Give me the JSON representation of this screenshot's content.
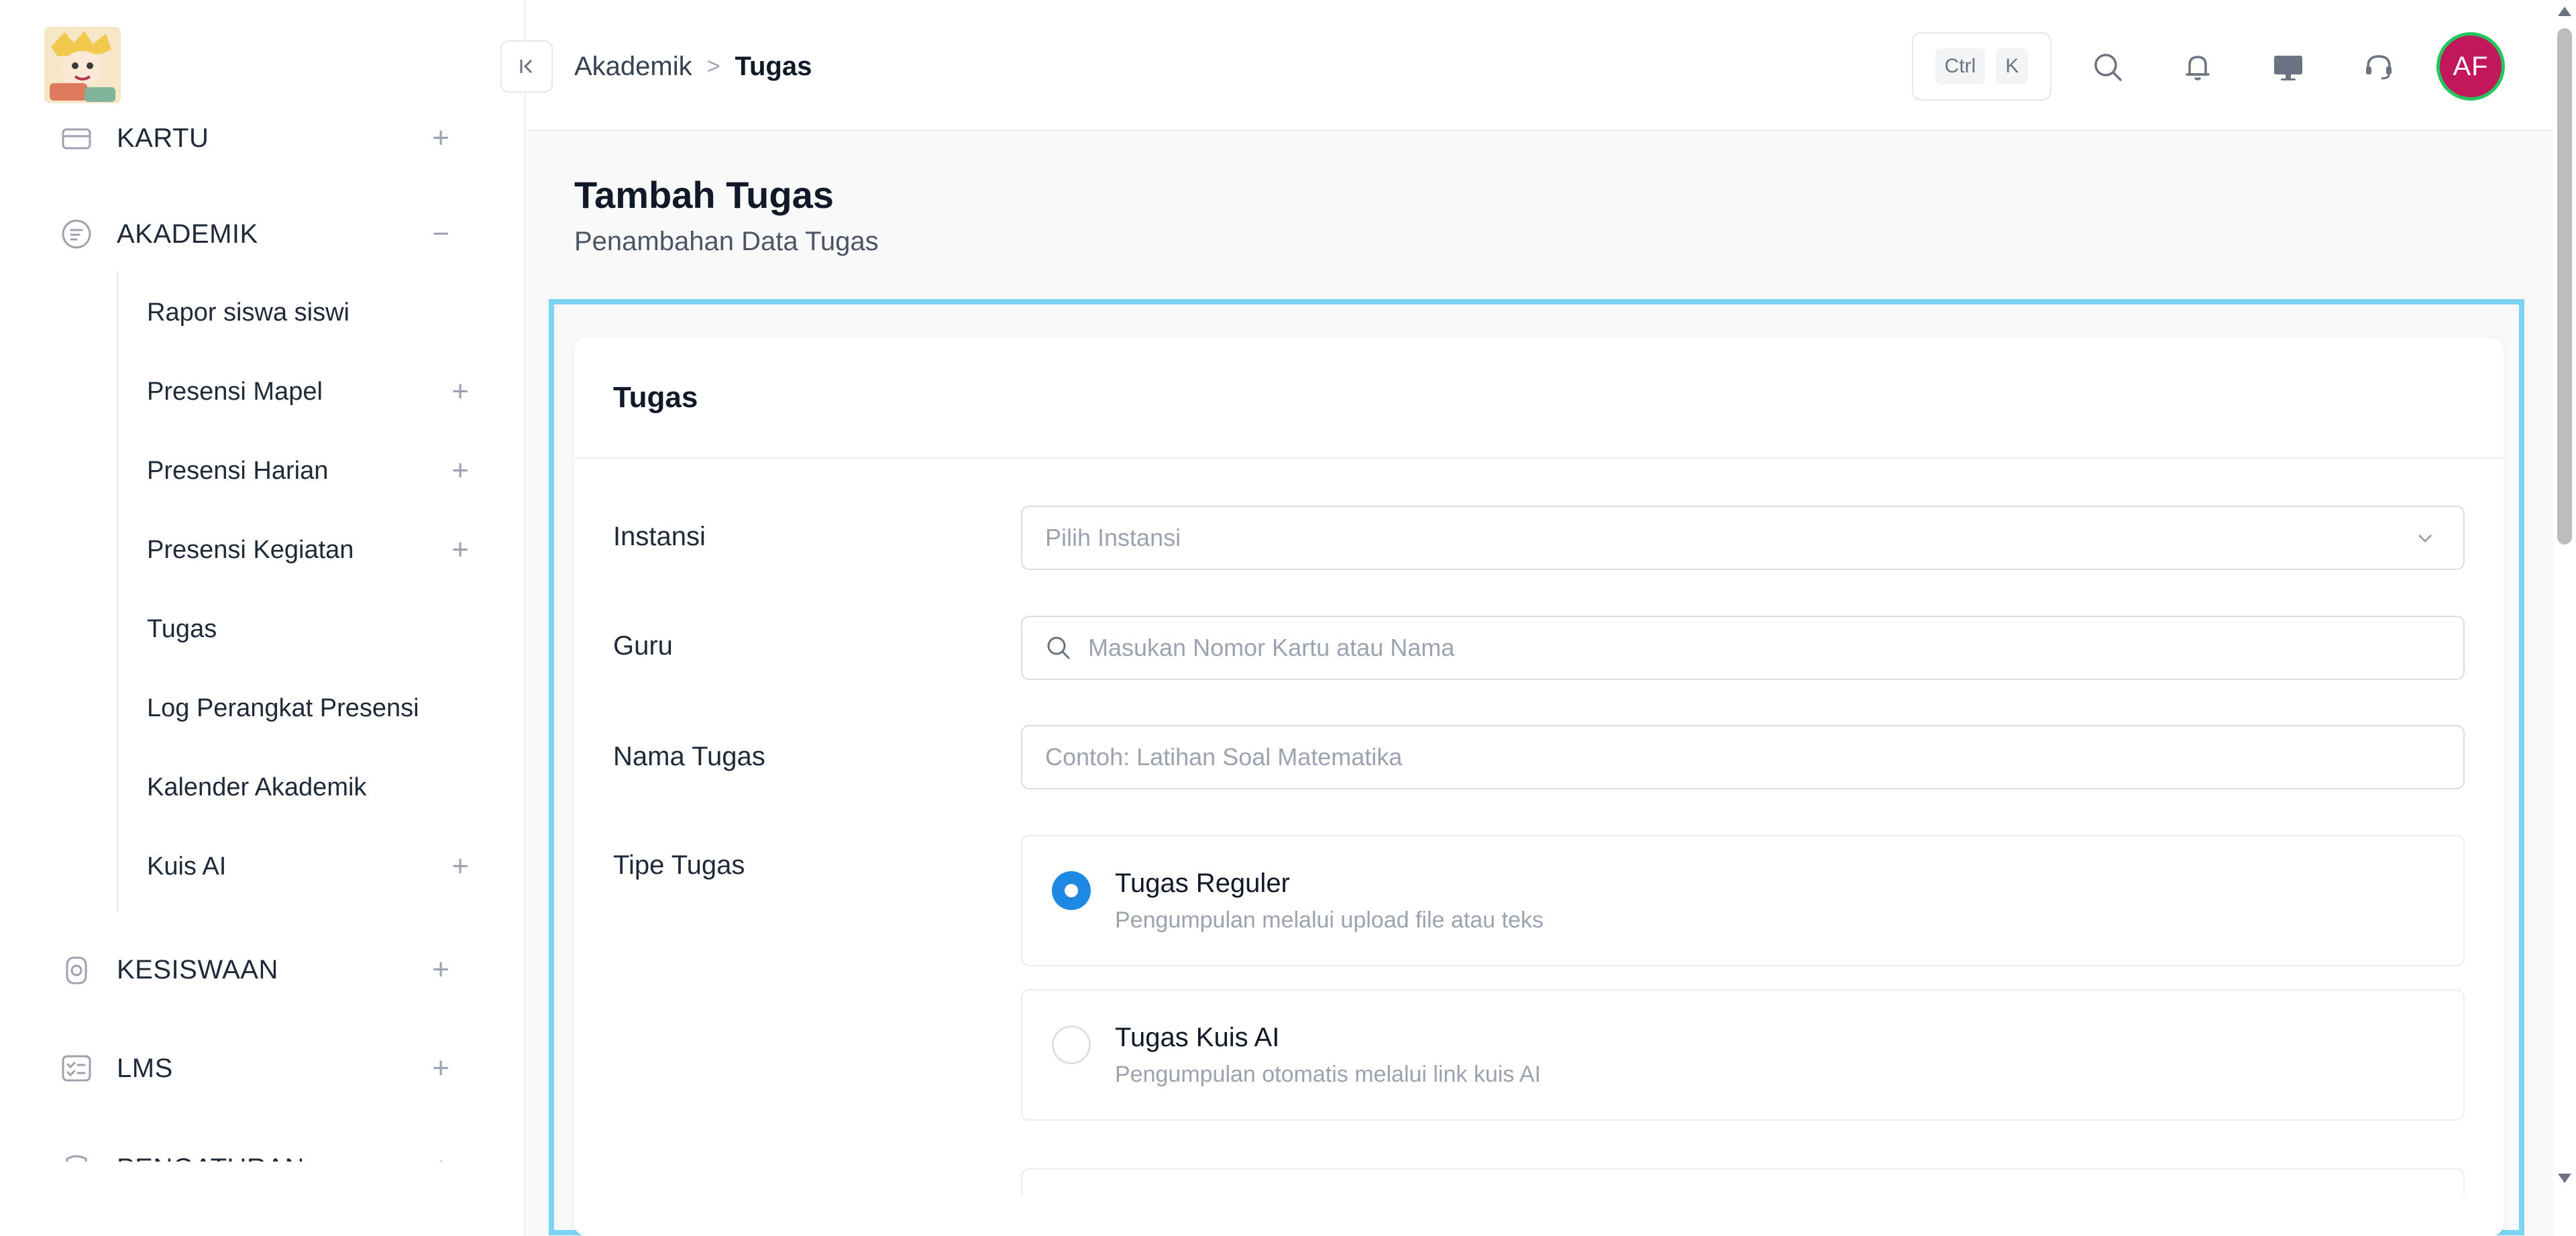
{
  "sidebar": {
    "top_items": [
      {
        "label": "KARTU",
        "toggle": "+"
      },
      {
        "label": "AKADEMIK",
        "toggle": "−"
      },
      {
        "label": "KESISWAAN",
        "toggle": "+"
      },
      {
        "label": "LMS",
        "toggle": "+"
      },
      {
        "label": "PENGATURAN",
        "toggle": "+"
      }
    ],
    "sub_items": [
      {
        "label": "Rapor siswa siswi",
        "toggle": ""
      },
      {
        "label": "Presensi Mapel",
        "toggle": "+"
      },
      {
        "label": "Presensi Harian",
        "toggle": "+"
      },
      {
        "label": "Presensi Kegiatan",
        "toggle": "+"
      },
      {
        "label": "Tugas",
        "toggle": ""
      },
      {
        "label": "Log Perangkat Presensi",
        "toggle": ""
      },
      {
        "label": "Kalender Akademik",
        "toggle": ""
      },
      {
        "label": "Kuis AI",
        "toggle": "+"
      }
    ]
  },
  "header": {
    "breadcrumb": [
      "Akademik",
      "Tugas"
    ],
    "breadcrumb_separator": ">",
    "shortcut_keys": [
      "Ctrl",
      "K"
    ],
    "avatar_initials": "AF",
    "icons": [
      "search-icon",
      "bell-icon",
      "monitor-icon",
      "headset-icon"
    ]
  },
  "page": {
    "title": "Tambah Tugas",
    "subtitle": "Penambahan Data Tugas"
  },
  "form": {
    "card_title": "Tugas",
    "instansi": {
      "label": "Instansi",
      "placeholder": "Pilih Instansi"
    },
    "guru": {
      "label": "Guru",
      "placeholder": "Masukan Nomor Kartu atau Nama"
    },
    "nama_tugas": {
      "label": "Nama Tugas",
      "placeholder": "Contoh: Latihan Soal Matematika"
    },
    "tipe_tugas": {
      "label": "Tipe Tugas",
      "options": [
        {
          "title": "Tugas Reguler",
          "desc": "Pengumpulan melalui upload file atau teks",
          "selected": true
        },
        {
          "title": "Tugas Kuis AI",
          "desc": "Pengumpulan otomatis melalui link kuis AI",
          "selected": false
        }
      ]
    }
  },
  "colors": {
    "accent": "#1e88e5",
    "highlight_border": "#7dd3f2",
    "avatar_bg": "#c2185b",
    "avatar_ring": "#22c55e"
  }
}
